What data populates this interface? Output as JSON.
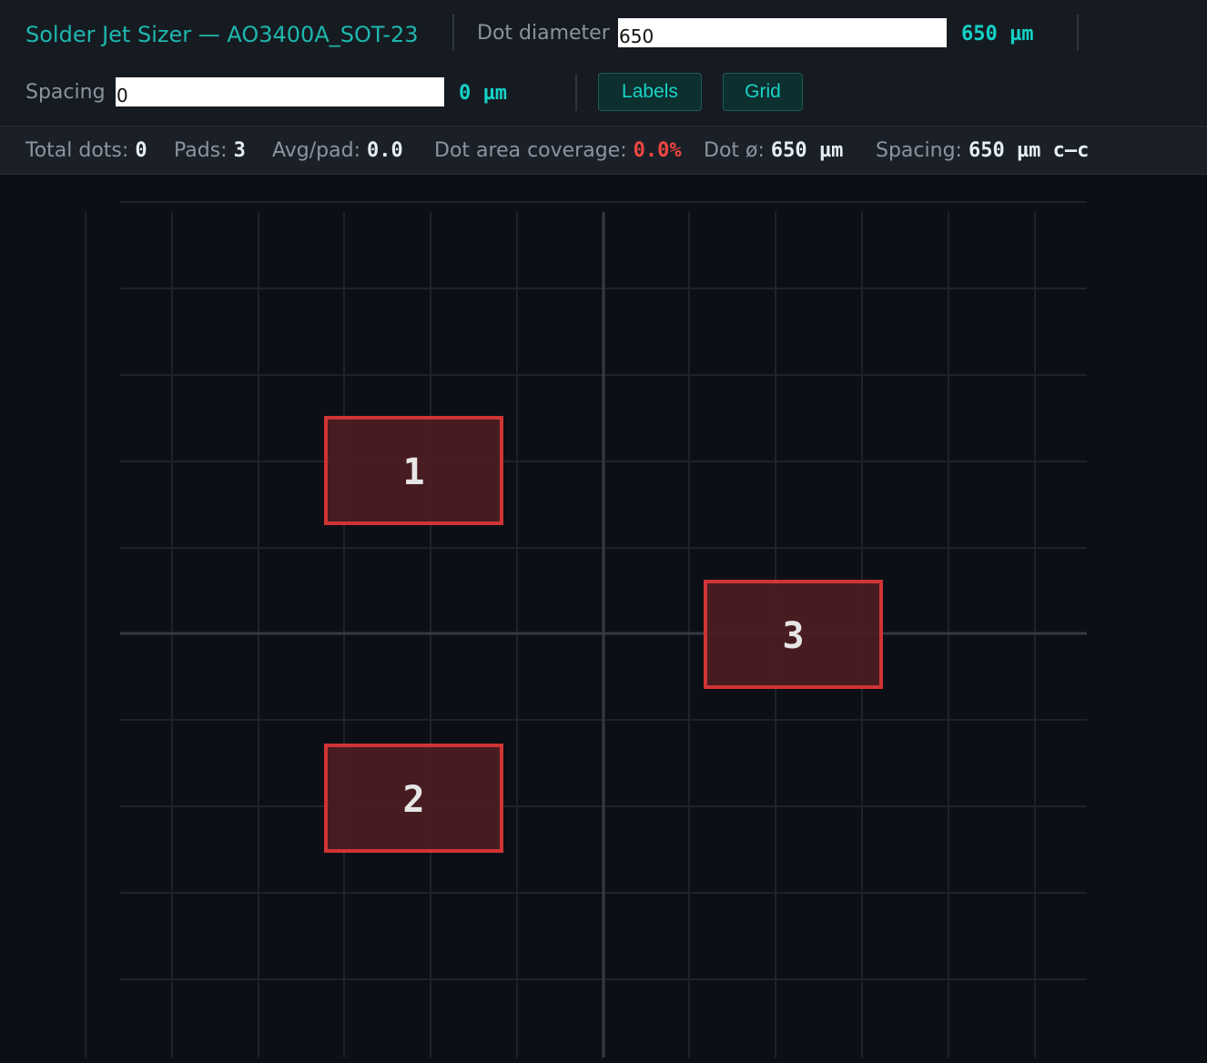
{
  "toolbar": {
    "title": "Solder Jet Sizer — AO3400A_SOT-23",
    "dot_diameter_label": "Dot diameter",
    "dot_diameter_value": "650",
    "dot_diameter_unit": "650 µm",
    "spacing_label": "Spacing",
    "spacing_value": "0",
    "spacing_unit": "0 µm",
    "labels_button": "Labels",
    "grid_button": "Grid"
  },
  "stats": {
    "total_dots_label": "Total dots:",
    "total_dots": "0",
    "pads_label": "Pads:",
    "pads": "3",
    "avg_label": "Avg/pad:",
    "avg": "0.0",
    "coverage_label": "Dot area coverage:",
    "coverage": "0.0%",
    "dot_dia_label": "Dot ø:",
    "dot_dia": "650 µm",
    "spacing_label": "Spacing:",
    "spacing": "650 µm c–c"
  },
  "pads": [
    {
      "label": "1"
    },
    {
      "label": "2"
    },
    {
      "label": "3"
    }
  ],
  "colors": {
    "accent": "#14d1c6",
    "pad_stroke": "#d03434",
    "pad_fill": "#4e1e22",
    "coverage_warn": "#f0473f"
  }
}
